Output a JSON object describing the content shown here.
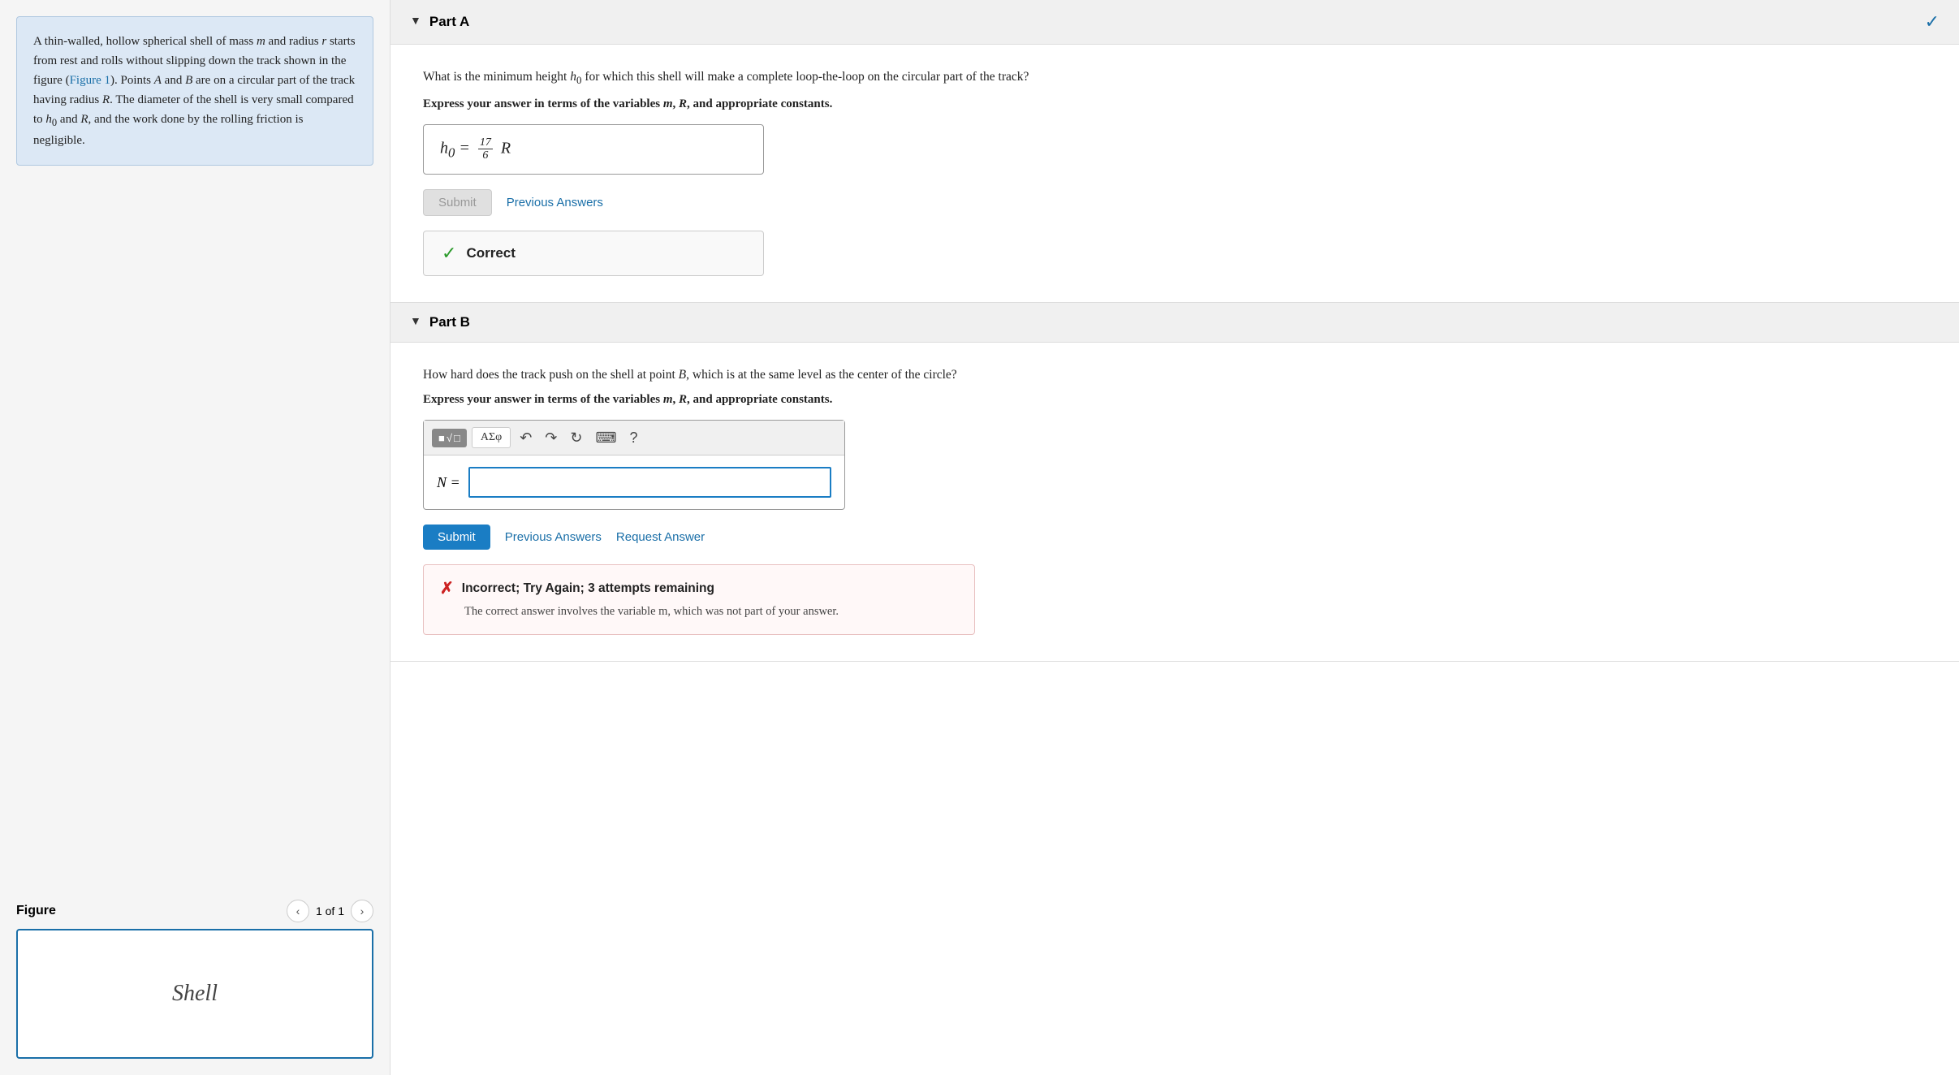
{
  "leftPanel": {
    "problemText": "A thin-walled, hollow spherical shell of mass",
    "massVar": "m",
    "problemText2": "and radius",
    "radiusVar": "r",
    "problemText3": "starts from rest and rolls without slipping down the track shown in the figure (",
    "figureLink": "Figure 1",
    "problemText4": "). Points",
    "pointA": "A",
    "problemText5": "and",
    "pointB": "B",
    "problemText6": "are on a circular part of the track having radius",
    "radiusR": "R",
    "problemText7": ". The diameter of the shell is very small compared to",
    "h0Var": "h₀",
    "problemText8": "and",
    "rVar": "R",
    "problemText9": ", and the work done by the rolling friction is negligible.",
    "figureSection": {
      "label": "Figure",
      "pageIndicator": "1 of 1",
      "shellLabel": "Shell"
    }
  },
  "rightPanel": {
    "partA": {
      "label": "Part A",
      "hasCheckmark": true,
      "questionText": "What is the minimum height",
      "h0": "h₀",
      "questionText2": "for which this shell will make a complete loop-the-loop on the circular part of the track?",
      "expressNote": "Express your answer in terms of the variables m, R, and appropriate constants.",
      "answerDisplay": "h₀ = 17/6 R",
      "submitLabel": "Submit",
      "previousAnswersLabel": "Previous Answers",
      "correctLabel": "Correct"
    },
    "partB": {
      "label": "Part B",
      "questionText": "How hard does the track push on the shell at point",
      "pointB": "B",
      "questionText2": ", which is at the same level as the center of the circle?",
      "expressNote": "Express your answer in terms of the variables m, R, and appropriate constants.",
      "toolbar": {
        "mathBtn": "■√□",
        "greekBtn": "AΣφ",
        "undoBtn": "↶",
        "redoBtn": "↷",
        "resetBtn": "↻",
        "keyboardBtn": "⌨",
        "helpBtn": "?"
      },
      "inputLabel": "N =",
      "inputPlaceholder": "",
      "submitLabel": "Submit",
      "previousAnswersLabel": "Previous Answers",
      "requestAnswerLabel": "Request Answer",
      "incorrectBanner": {
        "icon": "✕",
        "title": "Incorrect; Try Again; 3 attempts remaining",
        "body": "The correct answer involves the variable m, which was not part of your answer."
      }
    }
  }
}
